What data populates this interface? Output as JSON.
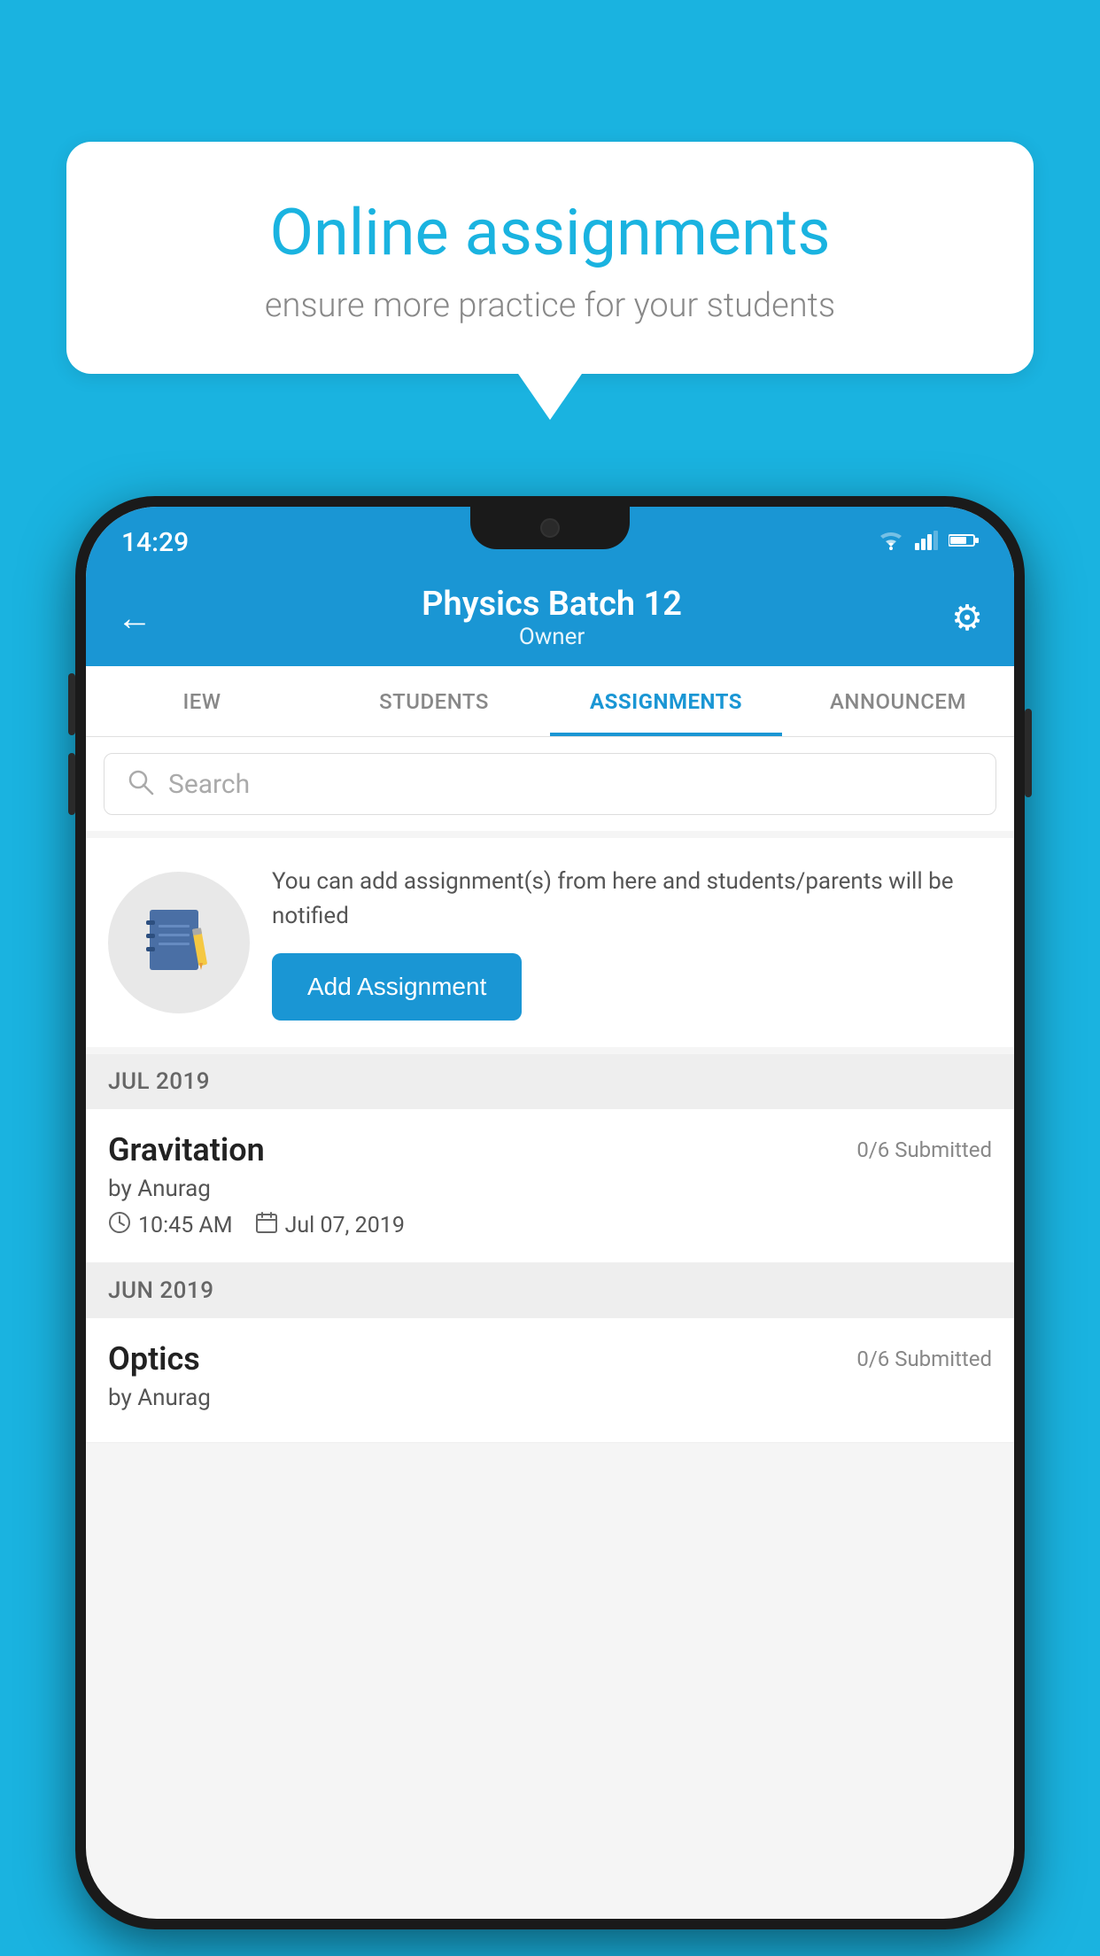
{
  "background": {
    "color": "#1ab3e0"
  },
  "speech_bubble": {
    "title": "Online assignments",
    "subtitle": "ensure more practice for your students"
  },
  "phone": {
    "status_bar": {
      "time": "14:29",
      "wifi_icon": "▾",
      "signal_icon": "▲",
      "battery_icon": "▮"
    },
    "header": {
      "title": "Physics Batch 12",
      "subtitle": "Owner",
      "back_label": "←",
      "settings_label": "⚙"
    },
    "tabs": [
      {
        "label": "IEW",
        "active": false
      },
      {
        "label": "STUDENTS",
        "active": false
      },
      {
        "label": "ASSIGNMENTS",
        "active": true
      },
      {
        "label": "ANNOUNCEM",
        "active": false
      }
    ],
    "search": {
      "placeholder": "Search"
    },
    "info_card": {
      "text": "You can add assignment(s) from here and students/parents will be notified",
      "button_label": "Add Assignment"
    },
    "months": [
      {
        "label": "JUL 2019",
        "assignments": [
          {
            "name": "Gravitation",
            "submitted": "0/6 Submitted",
            "by": "by Anurag",
            "time": "10:45 AM",
            "date": "Jul 07, 2019"
          }
        ]
      },
      {
        "label": "JUN 2019",
        "assignments": [
          {
            "name": "Optics",
            "submitted": "0/6 Submitted",
            "by": "by Anurag",
            "time": "",
            "date": ""
          }
        ]
      }
    ]
  }
}
